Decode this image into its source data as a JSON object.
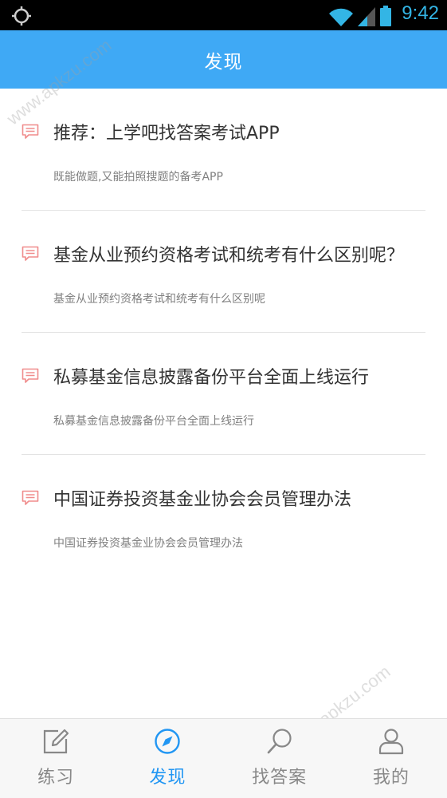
{
  "statusbar": {
    "time": "9:42",
    "icons": [
      "gps-icon",
      "wifi-icon",
      "signal-icon",
      "battery-icon"
    ]
  },
  "appbar": {
    "title": "发现"
  },
  "articles": [
    {
      "headline": "推荐：上学吧找答案考试APP",
      "summary": "既能做题,又能拍照搜题的备考APP"
    },
    {
      "headline": "基金从业预约资格考试和统考有什么区别呢？",
      "summary": "基金从业预约资格考试和统考有什么区别呢"
    },
    {
      "headline": "私募基金信息披露备份平台全面上线运行",
      "summary": "私募基金信息披露备份平台全面上线运行"
    },
    {
      "headline": "中国证券投资基金业协会会员管理办法",
      "summary": "中国证券投资基金业协会会员管理办法"
    }
  ],
  "tabs": [
    {
      "label": "练习",
      "icon": "edit-icon",
      "active": false
    },
    {
      "label": "发现",
      "icon": "compass-icon",
      "active": true
    },
    {
      "label": "找答案",
      "icon": "search-icon",
      "active": false
    },
    {
      "label": "我的",
      "icon": "user-icon",
      "active": false
    }
  ],
  "watermark": "www.apkzu.com",
  "colors": {
    "accent": "#3fa9f5",
    "active_tab": "#2196f3",
    "statusbar_icon": "#33b5e5",
    "message_icon": "#f08c8c"
  }
}
